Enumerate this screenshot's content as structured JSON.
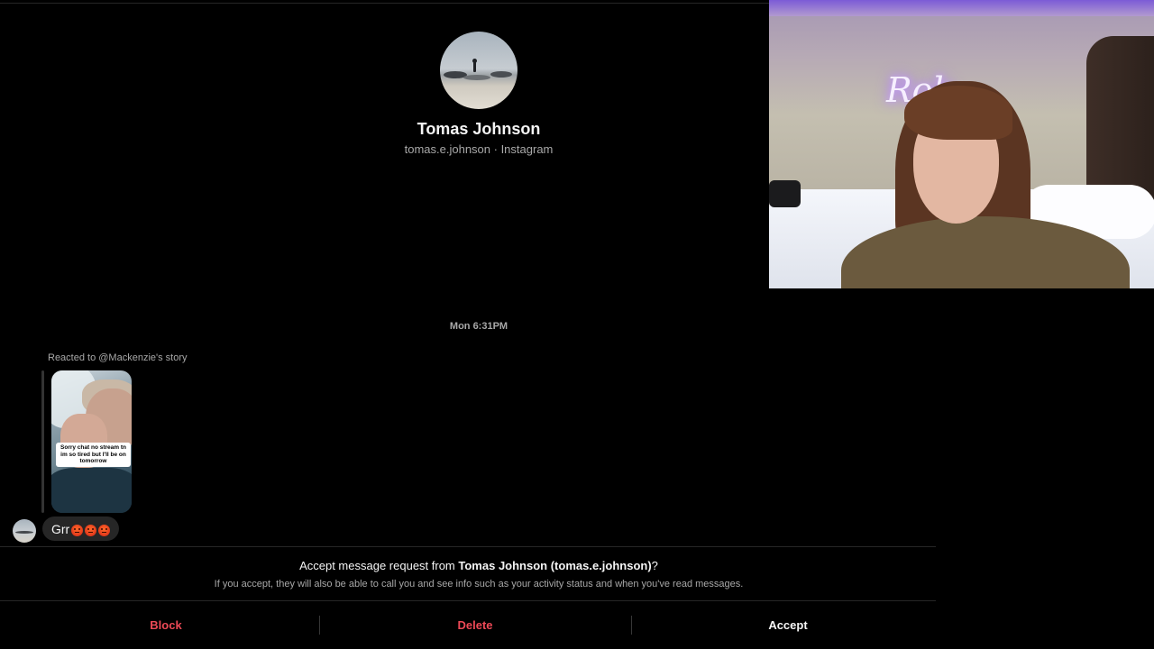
{
  "profile": {
    "name": "Tomas Johnson",
    "subtitle": "tomas.e.johnson · Instagram"
  },
  "thread": {
    "timestamp": "Mon 6:31PM",
    "reacted_label": "Reacted to @Mackenzie's story",
    "story_caption": "Sorry chat no stream tn im so tired but I'll be on tomorrow",
    "message_text": "Grr",
    "message_emojis": [
      "angry-face",
      "angry-face",
      "angry-face"
    ]
  },
  "request": {
    "title_prefix": "Accept message request from ",
    "title_name": "Tomas Johnson (tomas.e.johnson)",
    "title_suffix": "?",
    "subtitle": "If you accept, they will also be able to call you and see info such as your activity status and when you've read messages."
  },
  "actions": {
    "block": "Block",
    "delete": "Delete",
    "accept": "Accept"
  },
  "webcam": {
    "neon_sign": "Rob"
  },
  "colors": {
    "background": "#000000",
    "danger": "#ed4956",
    "muted_text": "#a8a8a8",
    "bubble": "#262626"
  }
}
